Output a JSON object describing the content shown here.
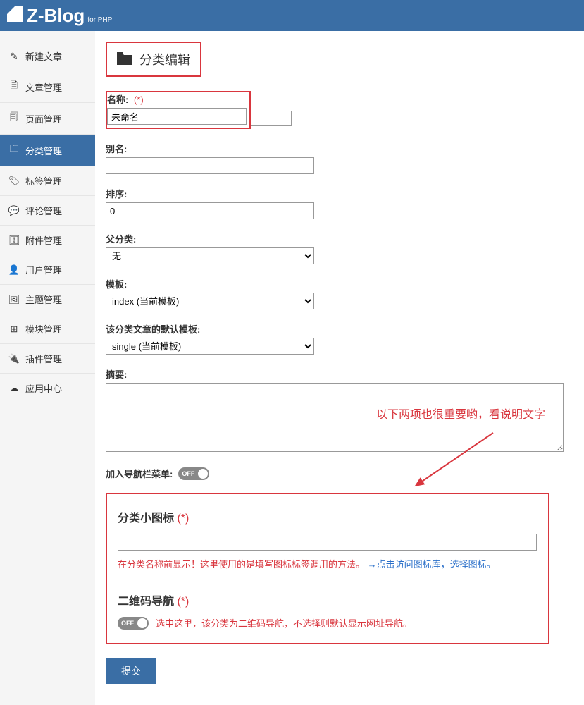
{
  "logo": {
    "text": "Z-Blog",
    "sub": "for PHP"
  },
  "sidebar": {
    "items": [
      {
        "label": "新建文章",
        "icon": "✎"
      },
      {
        "label": "文章管理",
        "icon": "🗎"
      },
      {
        "label": "页面管理",
        "icon": "🗐"
      },
      {
        "label": "分类管理",
        "icon": "🗀",
        "active": true
      },
      {
        "label": "标签管理",
        "icon": "🏷"
      },
      {
        "label": "评论管理",
        "icon": "💬"
      },
      {
        "label": "附件管理",
        "icon": "🗄"
      },
      {
        "label": "用户管理",
        "icon": "👤"
      },
      {
        "label": "主题管理",
        "icon": "🖼"
      },
      {
        "label": "模块管理",
        "icon": "⊞"
      },
      {
        "label": "插件管理",
        "icon": "🔌"
      },
      {
        "label": "应用中心",
        "icon": "☁"
      }
    ]
  },
  "page": {
    "title": "分类编辑"
  },
  "form": {
    "name": {
      "label": "名称:",
      "req": "(*)",
      "value": "未命名"
    },
    "alias": {
      "label": "别名:",
      "value": ""
    },
    "order": {
      "label": "排序:",
      "value": "0"
    },
    "parent": {
      "label": "父分类:",
      "value": "无"
    },
    "template": {
      "label": "模板:",
      "value": "index (当前模板)"
    },
    "article_template": {
      "label": "该分类文章的默认模板:",
      "value": "single (当前模板)"
    },
    "summary": {
      "label": "摘要:",
      "value": ""
    },
    "nav_menu": {
      "label": "加入导航栏菜单:",
      "state": "OFF"
    }
  },
  "annotation": "以下两项也很重要哟，看说明文字",
  "icon_section": {
    "title": "分类小图标",
    "req": "(*)",
    "value": "",
    "help_red": "在分类名称前显示！这里使用的是填写图标标签调用的方法。",
    "help_blue": "→点击访问图标库，选择图标。"
  },
  "qr_section": {
    "title": "二维码导航",
    "req": "(*)",
    "state": "OFF",
    "help": "选中这里，该分类为二维码导航，不选择则默认显示网址导航。"
  },
  "submit": "提交"
}
